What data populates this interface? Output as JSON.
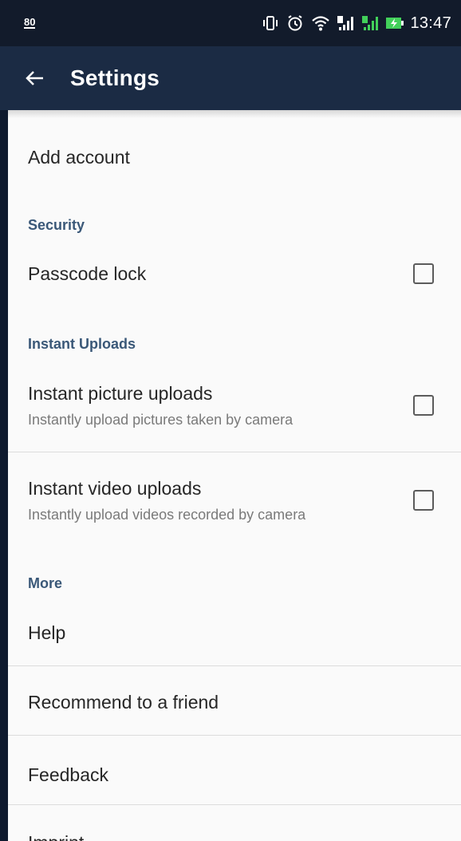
{
  "status_bar": {
    "left_badge": "80",
    "time": "13:47",
    "icons": [
      "vibrate-icon",
      "alarm-icon",
      "wifi-icon",
      "sim1-signal-icon",
      "sim2-signal-icon",
      "battery-charging-icon"
    ]
  },
  "app_bar": {
    "title": "Settings",
    "back_icon": "back-arrow-icon"
  },
  "settings": {
    "add_account": "Add account",
    "security_header": "Security",
    "passcode_lock": "Passcode lock",
    "instant_uploads_header": "Instant Uploads",
    "instant_picture_title": "Instant picture uploads",
    "instant_picture_sub": "Instantly upload pictures taken by camera",
    "instant_video_title": "Instant video uploads",
    "instant_video_sub": "Instantly upload videos recorded by camera",
    "more_header": "More",
    "help": "Help",
    "recommend": "Recommend to a friend",
    "feedback": "Feedback",
    "imprint": "Imprint"
  },
  "checkbox_states": {
    "passcode_lock": false,
    "instant_picture": false,
    "instant_video": false
  },
  "colors": {
    "status_bar_bg": "#121b2b",
    "app_bar_bg": "#1b2b44",
    "section_header": "#3a5878",
    "background": "#fafafa"
  }
}
